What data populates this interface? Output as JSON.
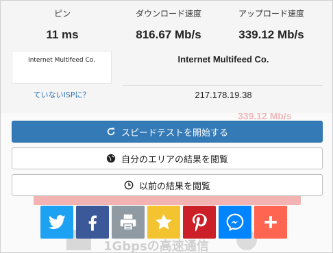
{
  "stats": {
    "ping_label": "ピン",
    "download_label": "ダウンロード速度",
    "upload_label": "アップロード速度",
    "ping_value": "11 ms",
    "download_value": "816.67 Mb/s",
    "upload_value": "339.12 Mb/s"
  },
  "provider": {
    "logo_text": "Internet Multifeed Co.",
    "name": "Internet Multifeed Co.",
    "isp_link": "ていないISPに？",
    "ip": "217.178.19.38"
  },
  "buttons": {
    "start": "スピードテストを開始する",
    "area": "自分のエリアの結果を閲覧",
    "previous": "以前の結果を閲覧"
  },
  "background": {
    "faded_speed": "339.12 Mb/s",
    "faded_tagline": "1Gbpsの高速通信"
  },
  "share": [
    {
      "name": "twitter-icon",
      "color": "#1da1f2"
    },
    {
      "name": "facebook-icon",
      "color": "#3b5998"
    },
    {
      "name": "print-icon",
      "color": "#909aa3"
    },
    {
      "name": "favorite-star-icon",
      "color": "#f4c430"
    },
    {
      "name": "pinterest-icon",
      "color": "#cb2027"
    },
    {
      "name": "messenger-icon",
      "color": "#0084ff"
    },
    {
      "name": "plus-icon",
      "color": "#ff6550"
    }
  ]
}
